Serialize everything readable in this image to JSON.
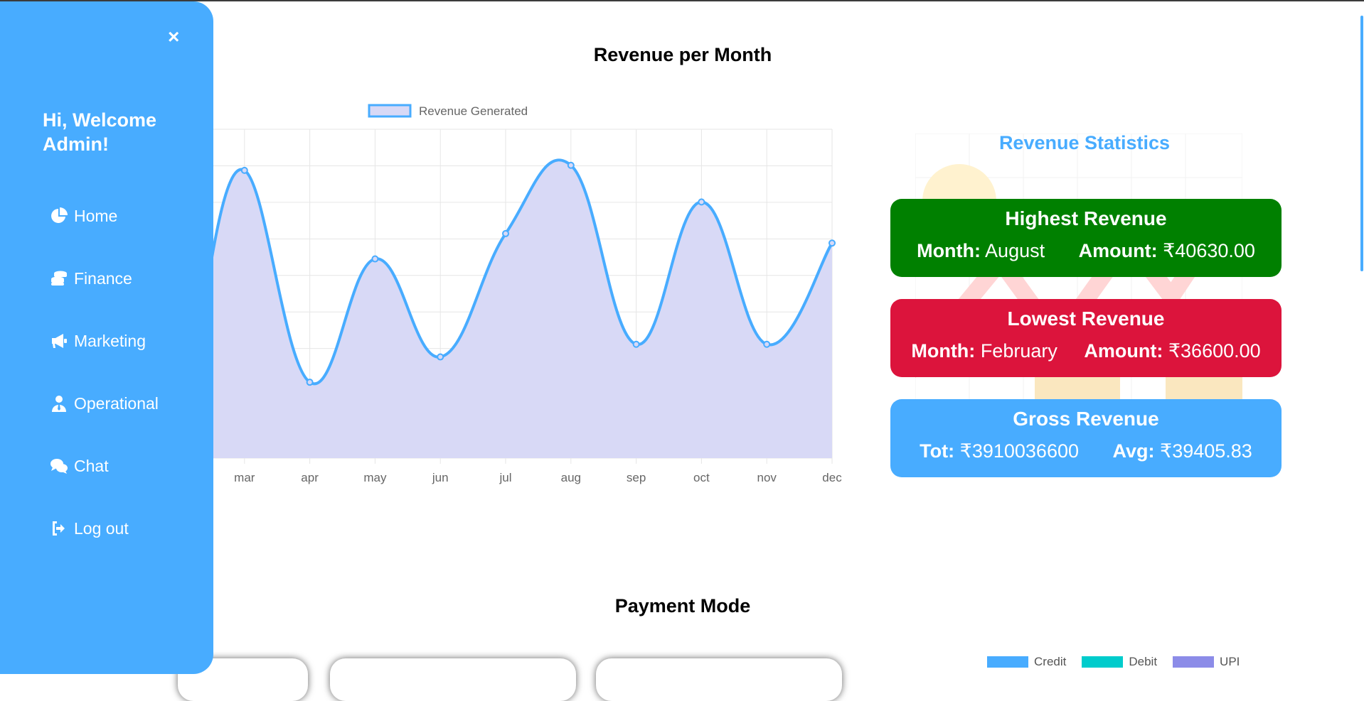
{
  "sidebar": {
    "close_glyph": "×",
    "welcome": "Hi, Welcome Admin!",
    "items": [
      {
        "label": "Home",
        "icon": "pie-chart-icon"
      },
      {
        "label": "Finance",
        "icon": "coins-icon"
      },
      {
        "label": "Marketing",
        "icon": "megaphone-icon"
      },
      {
        "label": "Operational",
        "icon": "user-tie-icon"
      },
      {
        "label": "Chat",
        "icon": "comments-icon"
      },
      {
        "label": "Log out",
        "icon": "sign-out-icon"
      }
    ]
  },
  "revenue": {
    "title": "Revenue per Month"
  },
  "statistics": {
    "title": "Revenue Statistics",
    "highest": {
      "heading": "Highest Revenue",
      "month_label": "Month:",
      "month": "August",
      "amount_label": "Amount:",
      "amount": "₹40630.00"
    },
    "lowest": {
      "heading": "Lowest Revenue",
      "month_label": "Month:",
      "month": "February",
      "amount_label": "Amount:",
      "amount": "₹36600.00"
    },
    "gross": {
      "heading": "Gross Revenue",
      "tot_label": "Tot:",
      "tot": "₹3910036600",
      "avg_label": "Avg:",
      "avg": "₹39405.83"
    }
  },
  "payment": {
    "title": "Payment Mode",
    "legend": [
      {
        "label": "Credit",
        "color": "#48acff"
      },
      {
        "label": "Debit",
        "color": "#00cccc"
      },
      {
        "label": "UPI",
        "color": "#8c8ce8"
      }
    ]
  },
  "colors": {
    "accent": "#48acff",
    "high": "#008000",
    "low": "#dc143c",
    "fill": "#d8d9f6"
  },
  "chart_data": {
    "type": "line",
    "categories": [
      "mar",
      "apr",
      "may",
      "jun",
      "jul",
      "aug",
      "sep",
      "oct",
      "nov",
      "dec"
    ],
    "series": [
      {
        "name": "Revenue Generated",
        "values": [
          40550,
          37200,
          39150,
          37600,
          39550,
          40630,
          37800,
          40050,
          37800,
          39400
        ]
      }
    ],
    "ylim": [
      36000,
      41200
    ],
    "grid": true,
    "legend": "top",
    "area_fill": true
  }
}
